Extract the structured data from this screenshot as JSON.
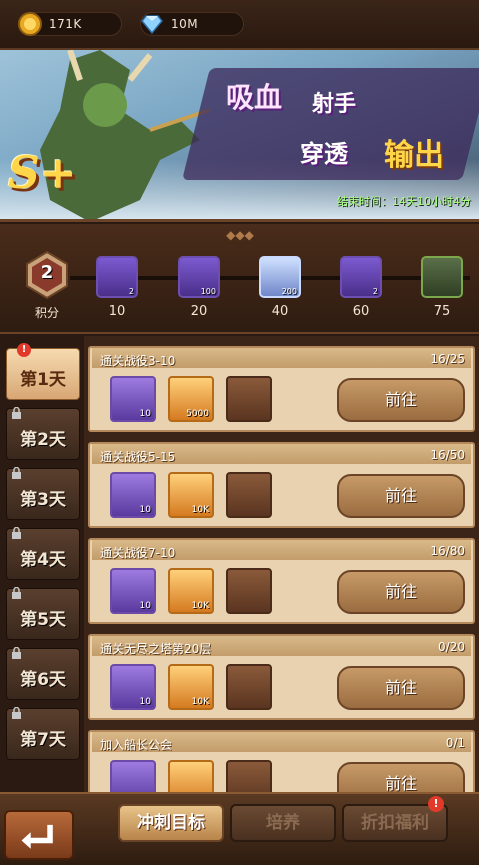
{
  "currency": {
    "gold": {
      "icon": "gold-coin-icon",
      "value": "171K"
    },
    "gems": {
      "icon": "diamond-icon",
      "value": "10M"
    }
  },
  "banner": {
    "title_a": "吸血",
    "title_b": "射手",
    "title_c": "穿透",
    "title_d": "输出",
    "grade": "S+",
    "end_time": "结束时间：14天10小时4分"
  },
  "milestones": {
    "points_value": "2",
    "points_label": "积分",
    "items": [
      {
        "icon": "scroll-card-icon",
        "count": "2",
        "threshold": "10"
      },
      {
        "icon": "purple-crystal-icon",
        "count": "100",
        "threshold": "20"
      },
      {
        "icon": "diamond-icon",
        "count": "200",
        "threshold": "40"
      },
      {
        "icon": "scroll-card-icon",
        "count": "2",
        "threshold": "60"
      },
      {
        "icon": "hero-portrait-icon",
        "count": "",
        "threshold": "75"
      }
    ]
  },
  "days": [
    {
      "label": "第1天",
      "active": true,
      "locked": false
    },
    {
      "label": "第2天",
      "active": false,
      "locked": true
    },
    {
      "label": "第3天",
      "active": false,
      "locked": true
    },
    {
      "label": "第4天",
      "active": false,
      "locked": true
    },
    {
      "label": "第5天",
      "active": false,
      "locked": true
    },
    {
      "label": "第6天",
      "active": false,
      "locked": true
    },
    {
      "label": "第7天",
      "active": false,
      "locked": true
    }
  ],
  "tasks": [
    {
      "name": "通关战役3-10",
      "progress": "16/25",
      "rewards": [
        "10",
        "5000",
        ""
      ],
      "button": "前往"
    },
    {
      "name": "通关战役5-15",
      "progress": "16/50",
      "rewards": [
        "10",
        "10K",
        ""
      ],
      "button": "前往"
    },
    {
      "name": "通关战役7-10",
      "progress": "16/80",
      "rewards": [
        "10",
        "10K",
        ""
      ],
      "button": "前往"
    },
    {
      "name": "通关无尽之塔第20层",
      "progress": "0/20",
      "rewards": [
        "10",
        "10K",
        ""
      ],
      "button": "前往"
    },
    {
      "name": "加入船长公会",
      "progress": "0/1",
      "rewards": [
        "",
        "",
        ""
      ],
      "button": "前往"
    }
  ],
  "bottom_tabs": [
    "冲刺目标",
    "培养",
    "折扣福利"
  ],
  "alert_mark": "!"
}
